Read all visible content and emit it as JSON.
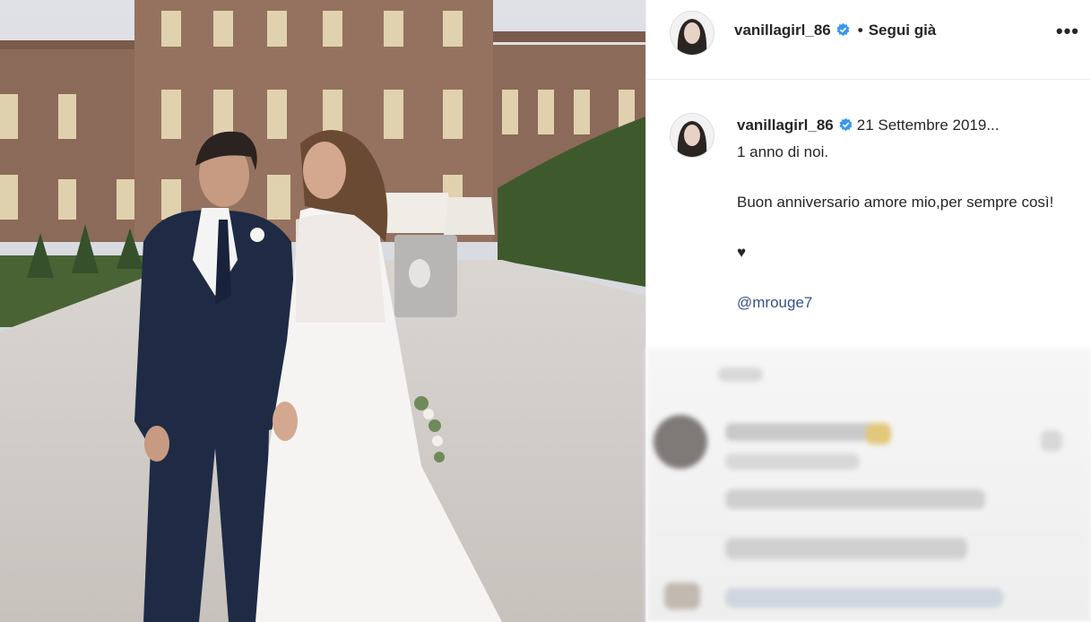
{
  "post": {
    "photo_alt": "",
    "photo_colors": {
      "sky": "#d9dbe0",
      "building": "#8f6d5c",
      "window_light": "#e8dcb8",
      "gravel": "#d3ceca",
      "hedge": "#3d5a2b",
      "suit": "#1e2a44",
      "dress": "#f5f3f2"
    }
  },
  "header": {
    "username": "vanillagirl_86",
    "separator": "•",
    "follow_label": "Segui già",
    "more_label": "•••"
  },
  "caption": {
    "username": "vanillagirl_86",
    "date": "21 Settembre 2019...",
    "lines": [
      "1 anno di noi.",
      "Buon anniversario amore mio,per sempre così!",
      "♥",
      "@mrouge7"
    ]
  },
  "colors": {
    "text": "#262626",
    "verified": "#3897f0",
    "mention": "#385185",
    "border": "#efefef"
  }
}
